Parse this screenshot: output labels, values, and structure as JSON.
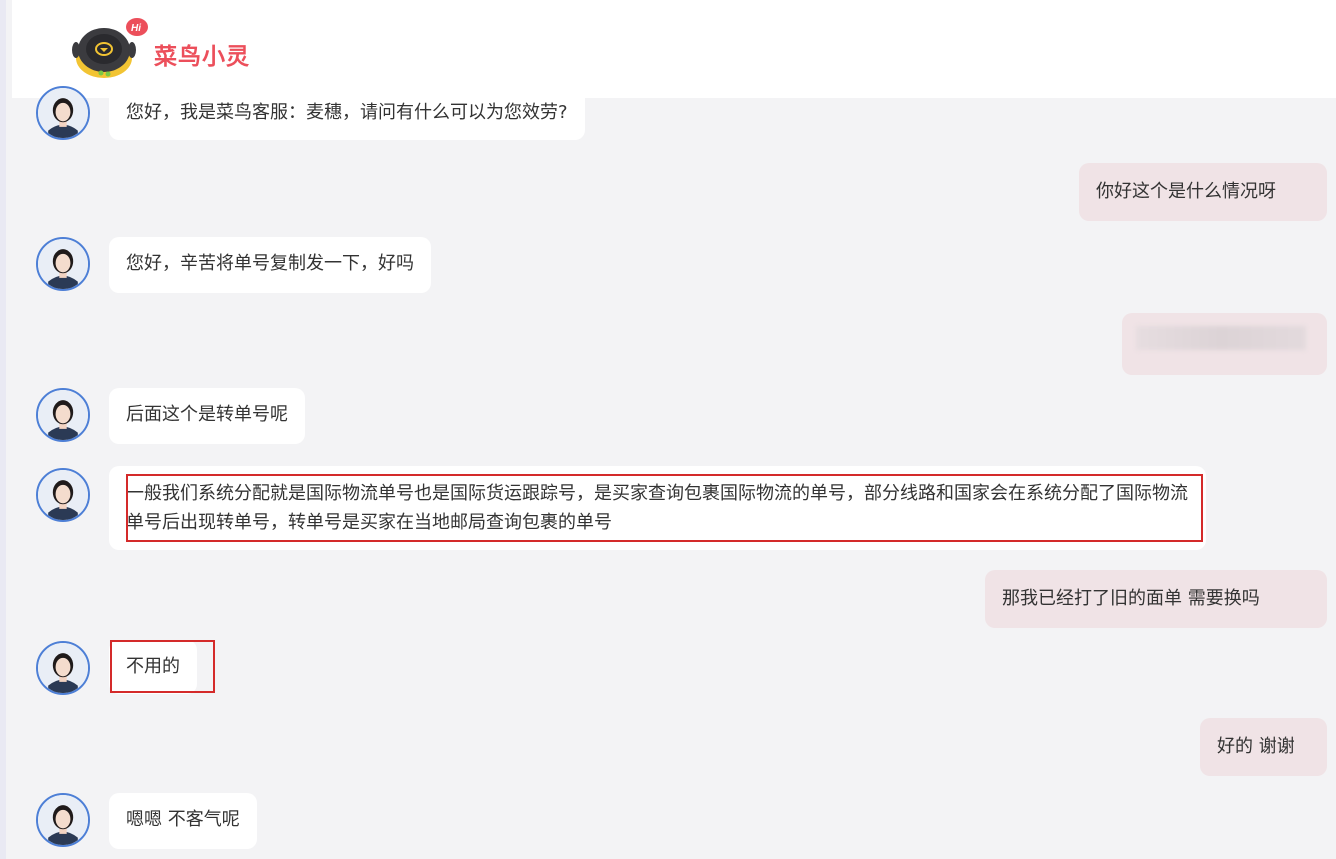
{
  "header": {
    "title": "菜鸟小灵",
    "badge": "Hi"
  },
  "messages": [
    {
      "from": "agent",
      "text": "您好，我是菜鸟客服：麦穗，请问有什么可以为您效劳?"
    },
    {
      "from": "user",
      "text": "你好这个是什么情况呀"
    },
    {
      "from": "agent",
      "text": "您好，辛苦将单号复制发一下，好吗"
    },
    {
      "from": "user",
      "text": ""
    },
    {
      "from": "agent",
      "text": "后面这个是转单号呢"
    },
    {
      "from": "agent",
      "text": "一般我们系统分配就是国际物流单号也是国际货运跟踪号，是买家查询包裹国际物流的单号，部分线路和国家会在系统分配了国际物流单号后出现转单号，转单号是买家在当地邮局查询包裹的单号"
    },
    {
      "from": "user",
      "text": "那我已经打了旧的面单 需要换吗"
    },
    {
      "from": "agent",
      "text": "不用的"
    },
    {
      "from": "user",
      "text": "好的 谢谢"
    },
    {
      "from": "agent",
      "text": "嗯嗯 不客气呢"
    }
  ],
  "colors": {
    "title": "#ec4f5b",
    "user_bubble": "#f0e3e6",
    "agent_bubble": "#ffffff",
    "highlight_box": "#d42a2a",
    "avatar_ring": "#4d7fd6"
  },
  "icons": {
    "logo": "cainiao-robot-logo",
    "avatar": "agent-avatar"
  }
}
